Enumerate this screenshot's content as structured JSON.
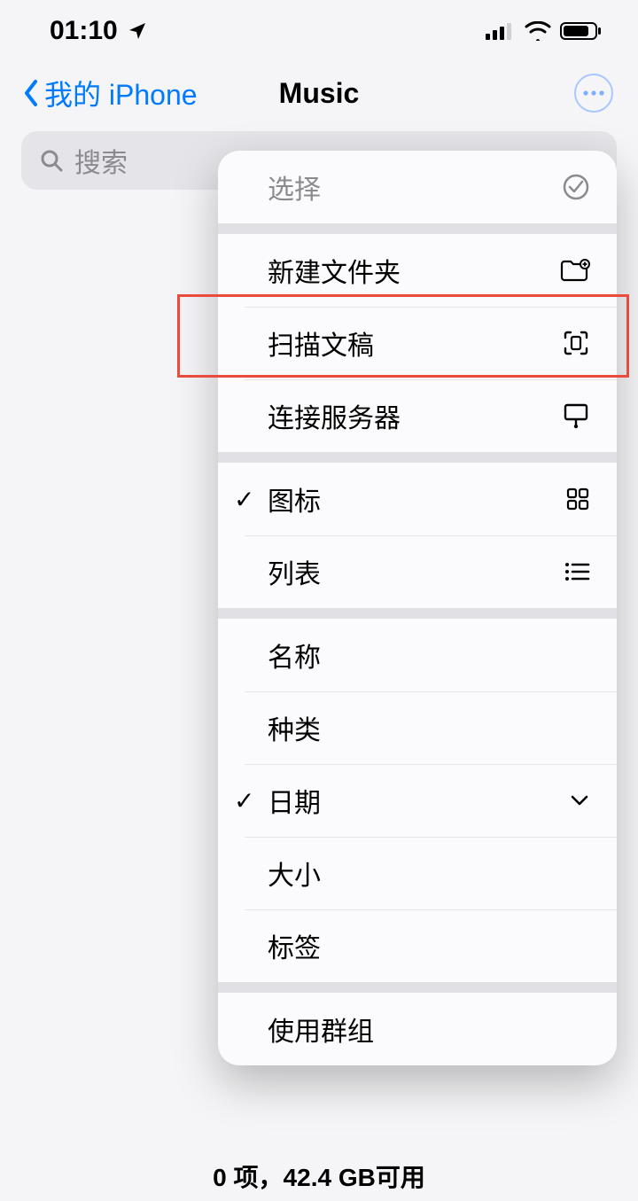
{
  "status": {
    "time": "01:10"
  },
  "nav": {
    "back": "我的 iPhone",
    "title": "Music"
  },
  "search": {
    "placeholder": "搜索"
  },
  "menu": {
    "g1": {
      "select": "选择"
    },
    "g2": {
      "newFolder": "新建文件夹",
      "scan": "扫描文稿",
      "connect": "连接服务器"
    },
    "g3": {
      "icons": "图标",
      "list": "列表"
    },
    "g4": {
      "name": "名称",
      "kind": "种类",
      "date": "日期",
      "size": "大小",
      "tags": "标签"
    },
    "g5": {
      "groups": "使用群组"
    }
  },
  "footer": {
    "items": "0 项",
    "avail": "42.4 GB可用"
  }
}
